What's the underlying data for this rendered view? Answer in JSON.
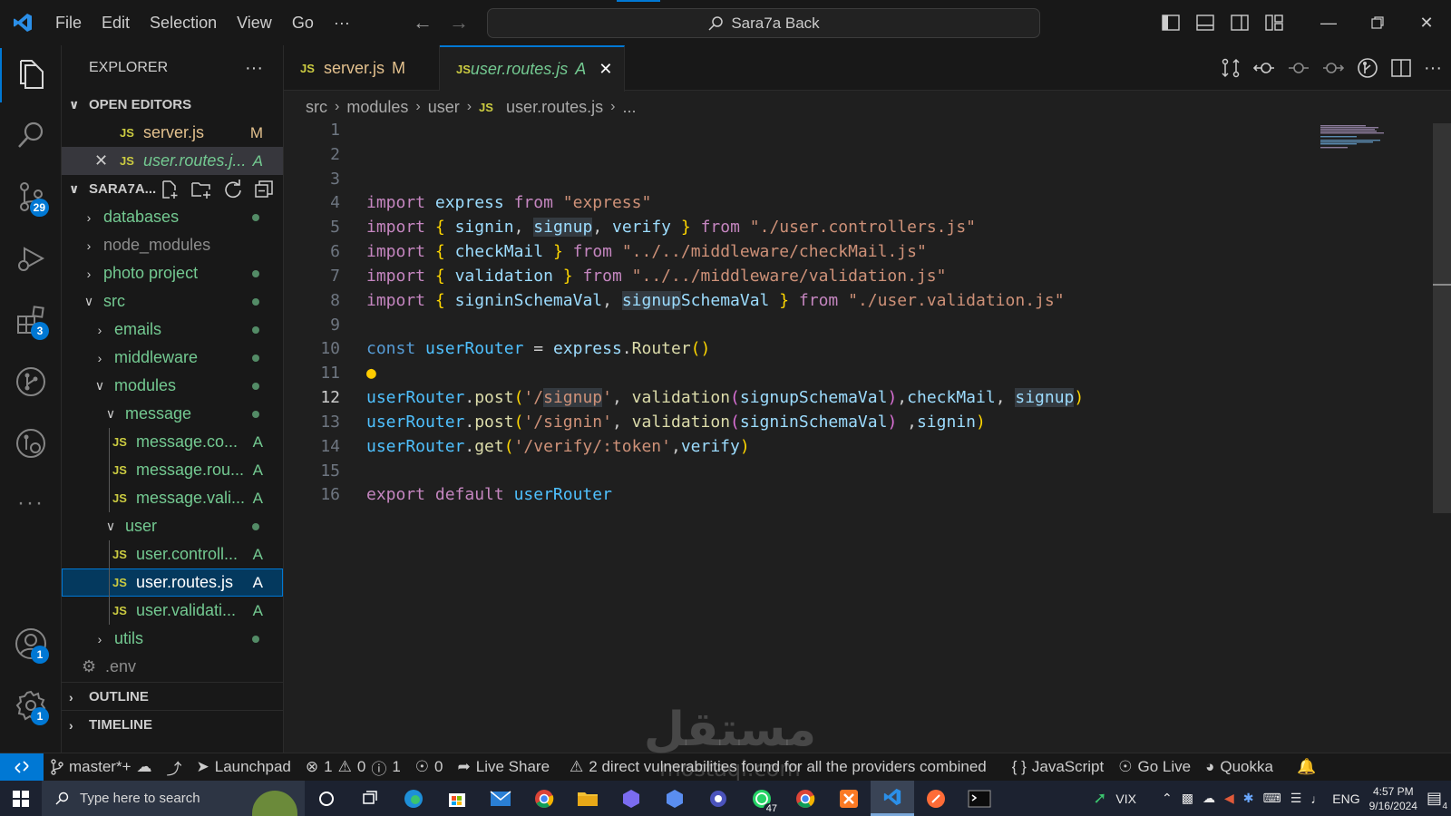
{
  "titlebar": {
    "menu": [
      "File",
      "Edit",
      "Selection",
      "View",
      "Go",
      "···"
    ],
    "search_text": "Sara7a Back",
    "window_controls": [
      "minimize",
      "restore",
      "close"
    ]
  },
  "activitybar": {
    "source_control_badge": "29",
    "extensions_badge": "3",
    "accounts_badge": "1",
    "settings_badge": "1",
    "more": "···"
  },
  "sidebar": {
    "title": "EXPLORER",
    "more": "···",
    "open_editors_label": "OPEN EDITORS",
    "open_editors": [
      {
        "icon": "JS",
        "name": "server.js",
        "status": "M"
      },
      {
        "icon": "JS",
        "name": "user.routes.j...",
        "status": "A"
      }
    ],
    "project_label": "SARA7A...",
    "tree": [
      {
        "name": "databases"
      },
      {
        "name": "node_modules"
      },
      {
        "name": "photo project"
      },
      {
        "name": "src"
      },
      {
        "name": "emails"
      },
      {
        "name": "middleware"
      },
      {
        "name": "modules"
      },
      {
        "name": "message"
      },
      {
        "name": "message.co...",
        "icon": "JS",
        "status": "A"
      },
      {
        "name": "message.rou...",
        "icon": "JS",
        "status": "A"
      },
      {
        "name": "message.vali...",
        "icon": "JS",
        "status": "A"
      },
      {
        "name": "user"
      },
      {
        "name": "user.controll...",
        "icon": "JS",
        "status": "A"
      },
      {
        "name": "user.routes.js",
        "icon": "JS",
        "status": "A"
      },
      {
        "name": "user.validati...",
        "icon": "JS",
        "status": "A"
      },
      {
        "name": "utils"
      },
      {
        "name": ".env"
      }
    ],
    "outline_label": "OUTLINE",
    "timeline_label": "TIMELINE"
  },
  "tabs": [
    {
      "icon": "JS",
      "name": "server.js",
      "status": "M"
    },
    {
      "icon": "JS",
      "name": "user.routes.js",
      "status": "A"
    }
  ],
  "breadcrumb": [
    "src",
    "modules",
    "user",
    "user.routes.js",
    "..."
  ],
  "code": {
    "line_numbers": [
      "1",
      "2",
      "3",
      "4",
      "5",
      "6",
      "7",
      "8",
      "9",
      "10",
      "11",
      "12",
      "13",
      "14",
      "15",
      "16"
    ],
    "current_line": "12"
  },
  "statusbar": {
    "branch": "master*+",
    "launchpad": "Launchpad",
    "errors": "1",
    "warnings": "0",
    "infos": "1",
    "ports": "0",
    "live_share": "Live Share",
    "vuln": "2 direct vulnerabilities found for all the providers combined",
    "language": "JavaScript",
    "go_live": "Go Live",
    "quokka": "Quokka"
  },
  "taskbar": {
    "search_placeholder": "Type here to search",
    "whatsapp_badge": "47",
    "vix": "VIX",
    "lang": "ENG",
    "time": "4:57 PM",
    "date": "9/16/2024",
    "notifications": "4"
  },
  "watermark": {
    "arabic": "مستقل",
    "latin": "mostaql.com"
  }
}
